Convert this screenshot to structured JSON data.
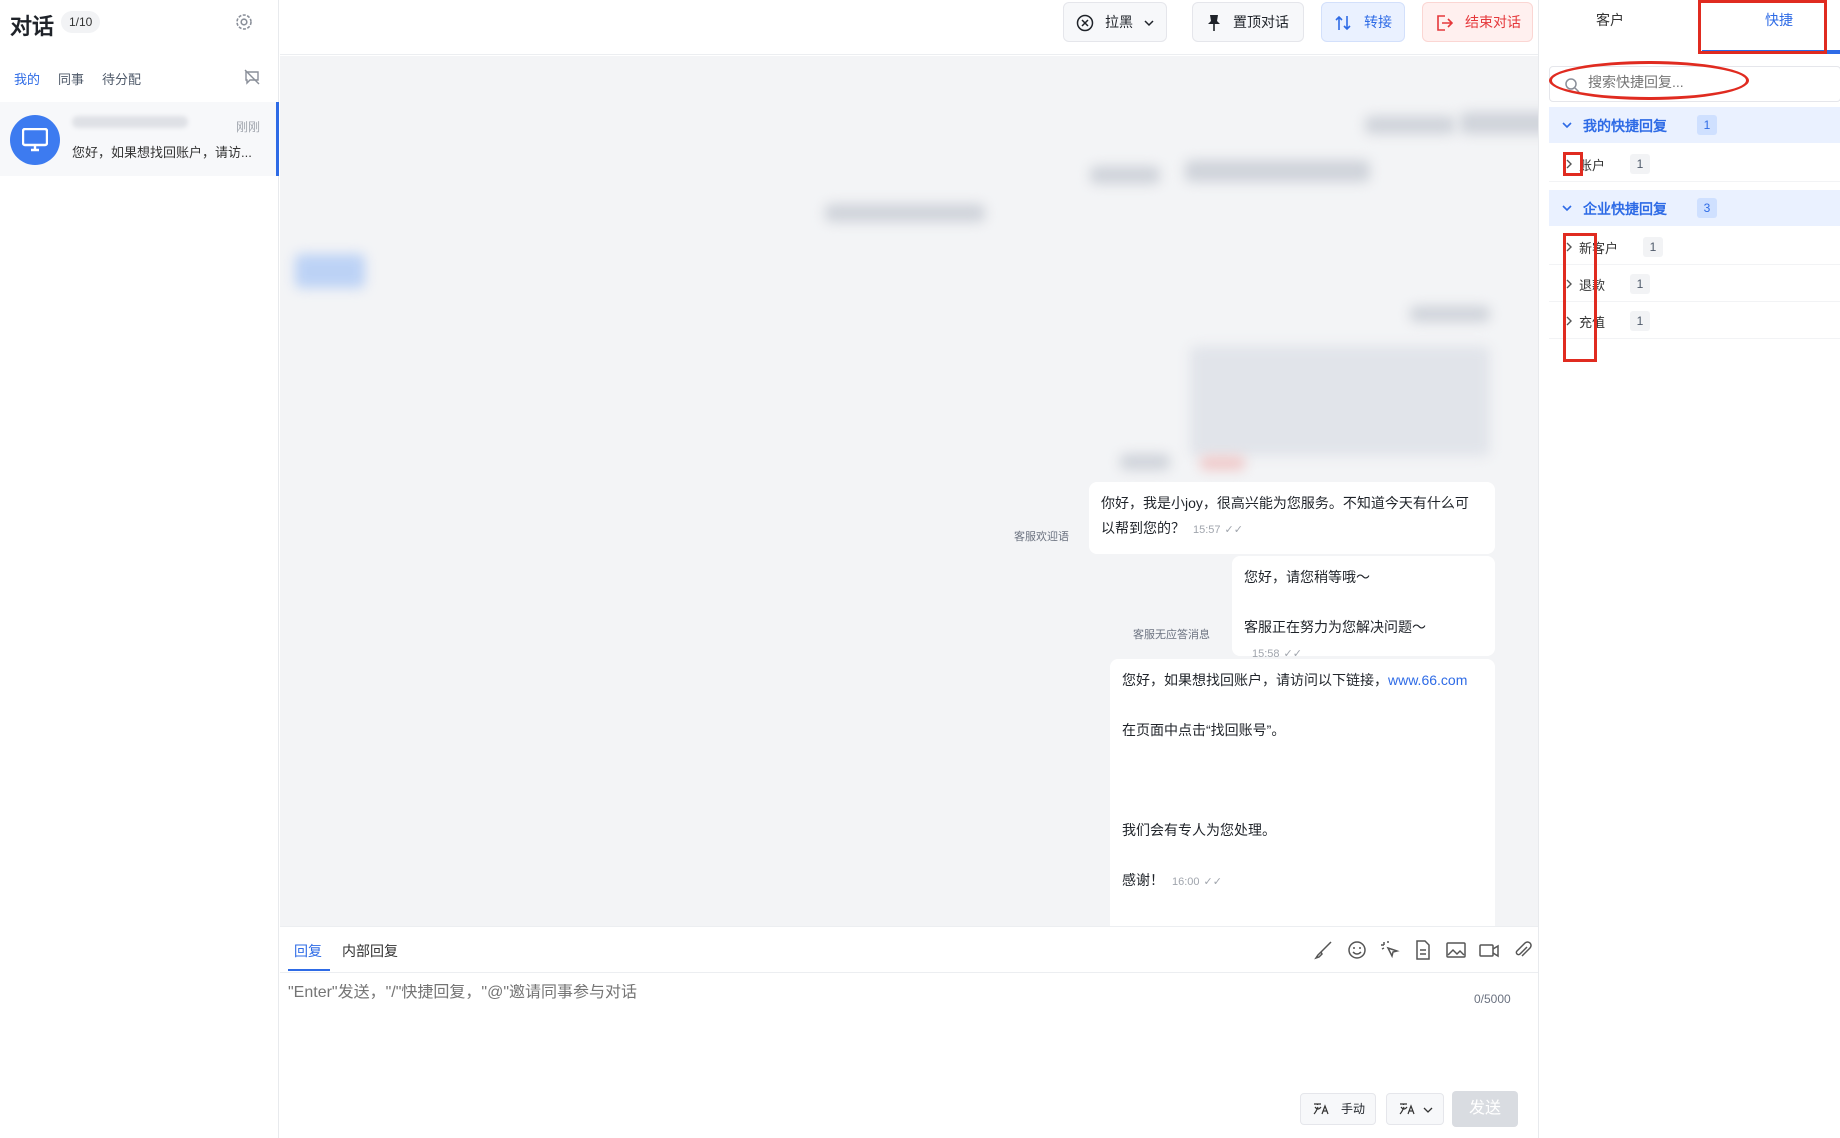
{
  "conversations_panel": {
    "title": "对话",
    "count": "1/10",
    "filters": [
      "我的",
      "同事",
      "待分配"
    ],
    "active_filter": "我的",
    "items": [
      {
        "time": "刚刚",
        "preview": "您好，如果想找回账户，请访..."
      }
    ]
  },
  "header": {
    "blacklist": "拉黑",
    "pin": "置顶对话",
    "transfer": "转接",
    "end": "结束对话"
  },
  "messages": [
    {
      "tag": "客服欢迎语",
      "lines": [
        "你好，我是小joy，很高兴能为您服务。不知道今天有什么可",
        "以帮到您的？"
      ],
      "time": "15:57"
    },
    {
      "tag": "客服无应答消息",
      "lines": [
        "您好，请您稍等哦～",
        "",
        "客服正在努力为您解决问题～"
      ],
      "time": "15:58"
    },
    {
      "lines": [
        "您好，如果想找回账户，请访问以下链接，",
        "",
        "在页面中点击“找回账号”。",
        "",
        "",
        "",
        "我们会有专人为您处理。",
        "",
        "感谢！"
      ],
      "link": "www.66.com",
      "time": "16:00"
    }
  ],
  "composer": {
    "tabs": [
      "回复",
      "内部回复"
    ],
    "active_tab": "回复",
    "placeholder": "\"Enter\"发送，\"/\"快捷回复，\"@\"邀请同事参与对话",
    "char_count": "0/5000",
    "manual_label": "手动",
    "send_label": "发送"
  },
  "right_panel": {
    "tabs": [
      "客户",
      "快捷"
    ],
    "active_tab": "快捷",
    "search_placeholder": "搜索快捷回复...",
    "sections": [
      {
        "title": "我的快捷回复",
        "count": "1",
        "items": [
          {
            "label": "账户",
            "count": "1"
          }
        ]
      },
      {
        "title": "企业快捷回复",
        "count": "3",
        "items": [
          {
            "label": "新客户",
            "count": "1"
          },
          {
            "label": "退款",
            "count": "1"
          },
          {
            "label": "充值",
            "count": "1"
          }
        ]
      }
    ]
  },
  "colors": {
    "accent": "#2e6be6",
    "danger": "#e5383b",
    "highlight": "#e02b20"
  }
}
